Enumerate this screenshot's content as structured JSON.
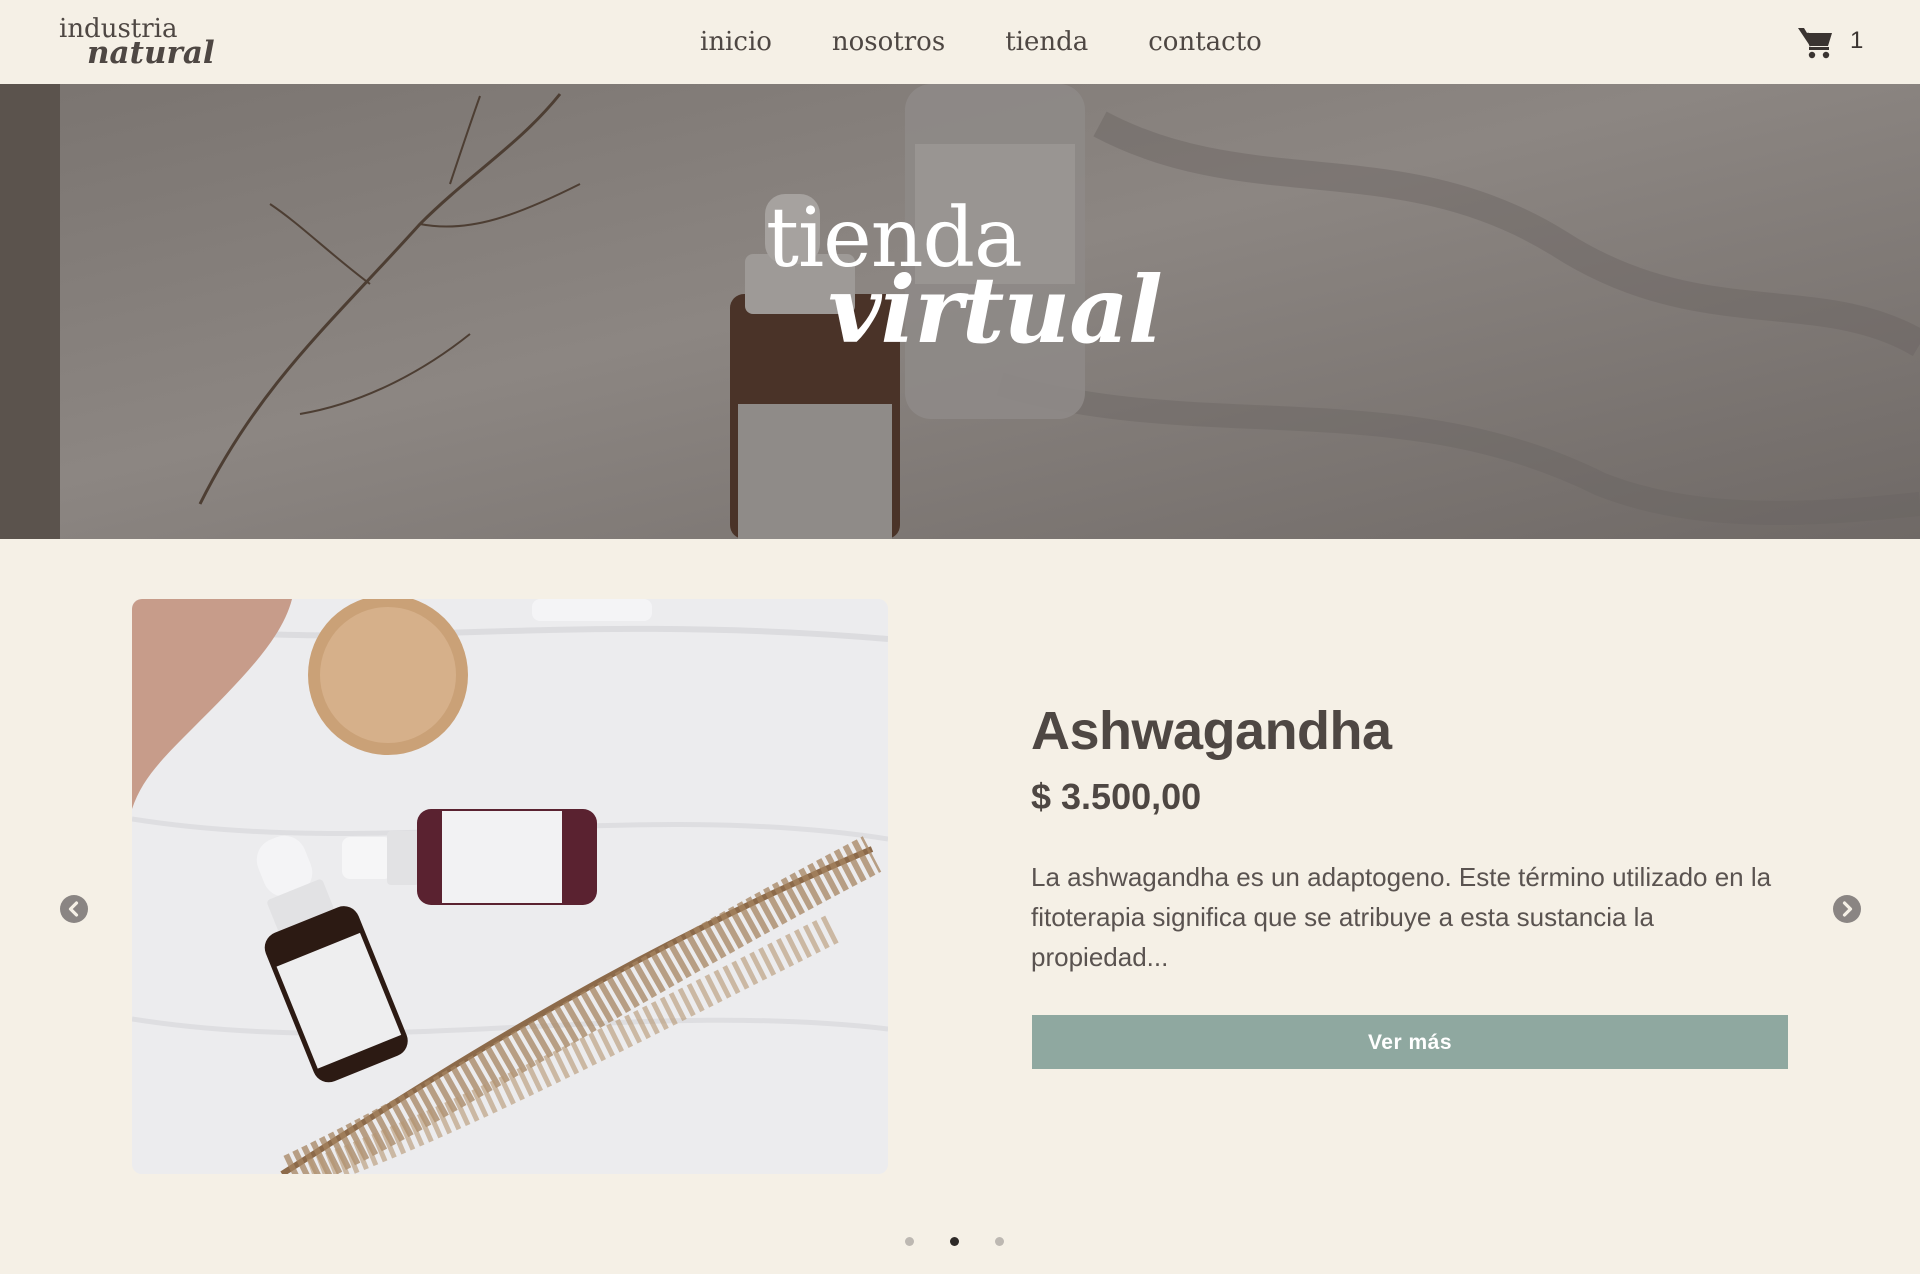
{
  "header": {
    "logo_top": "industria",
    "logo_bottom": "natural",
    "nav": [
      {
        "label": "inicio"
      },
      {
        "label": "nosotros"
      },
      {
        "label": "tienda"
      },
      {
        "label": "contacto"
      }
    ],
    "cart_icon": "shopping-cart-icon",
    "cart_count": "1"
  },
  "hero": {
    "title_line1": "tienda",
    "title_line2": "virtual"
  },
  "product": {
    "name": "Ashwagandha",
    "price": "$ 3.500,00",
    "description": "La ashwagandha es un adaptogeno. Este término utilizado en la fitoterapia significa que se atribuye a esta sustancia la propiedad...",
    "button_label": "Ver más"
  },
  "carousel": {
    "prev_icon": "chevron-left-icon",
    "next_icon": "chevron-right-icon",
    "slide_count": 3,
    "active_index": 1
  },
  "colors": {
    "background": "#f5f0e6",
    "text": "#4e4743",
    "button": "#8fa8a0",
    "hero_overlay": "#6a6461"
  }
}
